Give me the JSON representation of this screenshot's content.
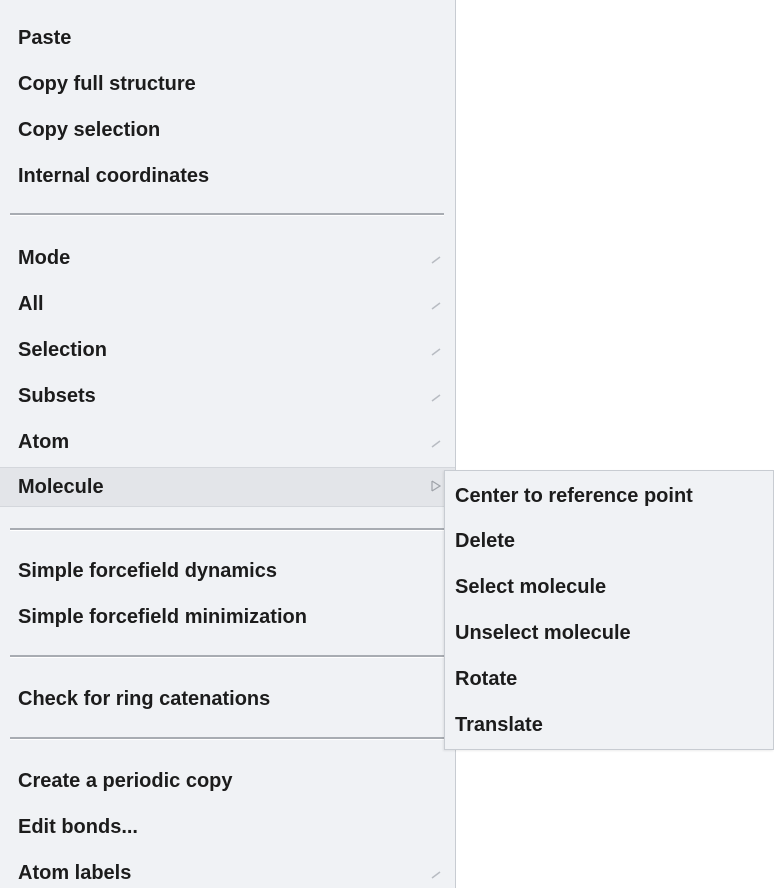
{
  "menu": {
    "group1": [
      {
        "label": "Paste"
      },
      {
        "label": "Copy full structure"
      },
      {
        "label": "Copy selection"
      },
      {
        "label": "Internal coordinates"
      }
    ],
    "group2": [
      {
        "label": "Mode",
        "has_submenu": true
      },
      {
        "label": "All",
        "has_submenu": true
      },
      {
        "label": "Selection",
        "has_submenu": true
      },
      {
        "label": "Subsets",
        "has_submenu": true
      },
      {
        "label": "Atom",
        "has_submenu": true
      },
      {
        "label": "Molecule",
        "has_submenu": true,
        "active": true
      }
    ],
    "group3": [
      {
        "label": "Simple forcefield dynamics"
      },
      {
        "label": "Simple forcefield minimization"
      }
    ],
    "group4": [
      {
        "label": "Check for ring catenations"
      }
    ],
    "group5": [
      {
        "label": "Create a periodic copy"
      },
      {
        "label": "Edit bonds..."
      },
      {
        "label": "Atom labels",
        "has_submenu": true
      }
    ]
  },
  "submenu": {
    "parent": "Molecule",
    "items": [
      {
        "label": "Center to reference point"
      },
      {
        "label": "Delete"
      },
      {
        "label": "Select molecule"
      },
      {
        "label": "Unselect molecule"
      },
      {
        "label": "Rotate"
      },
      {
        "label": "Translate"
      }
    ]
  },
  "icons": {
    "submenu_arrow": "chevron-right-icon"
  },
  "colors": {
    "menu_background": "#f0f2f5",
    "active_item_background": "#e3e5e9",
    "separator": "#a8acb2",
    "text": "#1c1c1c"
  }
}
